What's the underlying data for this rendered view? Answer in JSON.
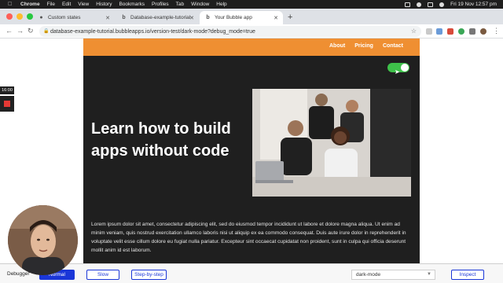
{
  "menubar": {
    "app": "Chrome",
    "items": [
      "File",
      "Edit",
      "View",
      "History",
      "Bookmarks",
      "Profiles",
      "Tab",
      "Window",
      "Help"
    ],
    "clock": "Fri 19 Nov  12:57 pm"
  },
  "tabs": [
    {
      "label": "Custom states",
      "icon": "bubble-logo-icon"
    },
    {
      "label": "Database-example-tutorial | B",
      "icon": "bubble-logo-icon"
    },
    {
      "label": "Your Bubble app",
      "icon": "bubble-logo-icon"
    }
  ],
  "address": {
    "url": "database-example-tutorial.bubbleapps.io/version-test/dark-mode?debug_mode=true"
  },
  "site": {
    "nav": [
      "About",
      "Pricing",
      "Contact"
    ],
    "hero_title": "Learn how to build apps without code",
    "body": "Lorem ipsum dolor sit amet, consectetur adipiscing elit, sed do eiusmod tempor incididunt ut labore et dolore magna aliqua. Ut enim ad minim veniam, quis nostrud exercitation ullamco laboris nisi ut aliquip ex ea commodo consequat. Duis aute irure dolor in reprehenderit in voluptate velit esse cillum dolore eu fugiat nulla pariatur. Excepteur sint occaecat cupidatat non proident, sunt in culpa qui officia deserunt mollit anim id est laborum.",
    "dark_mode_on": true
  },
  "recorder": {
    "timer": "16:00"
  },
  "debugger": {
    "label": "Debugger",
    "normal": "Normal",
    "slow": "Slow",
    "step": "Step-by-step",
    "page": "dark-mode",
    "inspect": "Inspect"
  },
  "colors": {
    "header": "#ef8f32",
    "toggle_on": "#3ec14a",
    "debug_accent": "#1a36d8"
  }
}
